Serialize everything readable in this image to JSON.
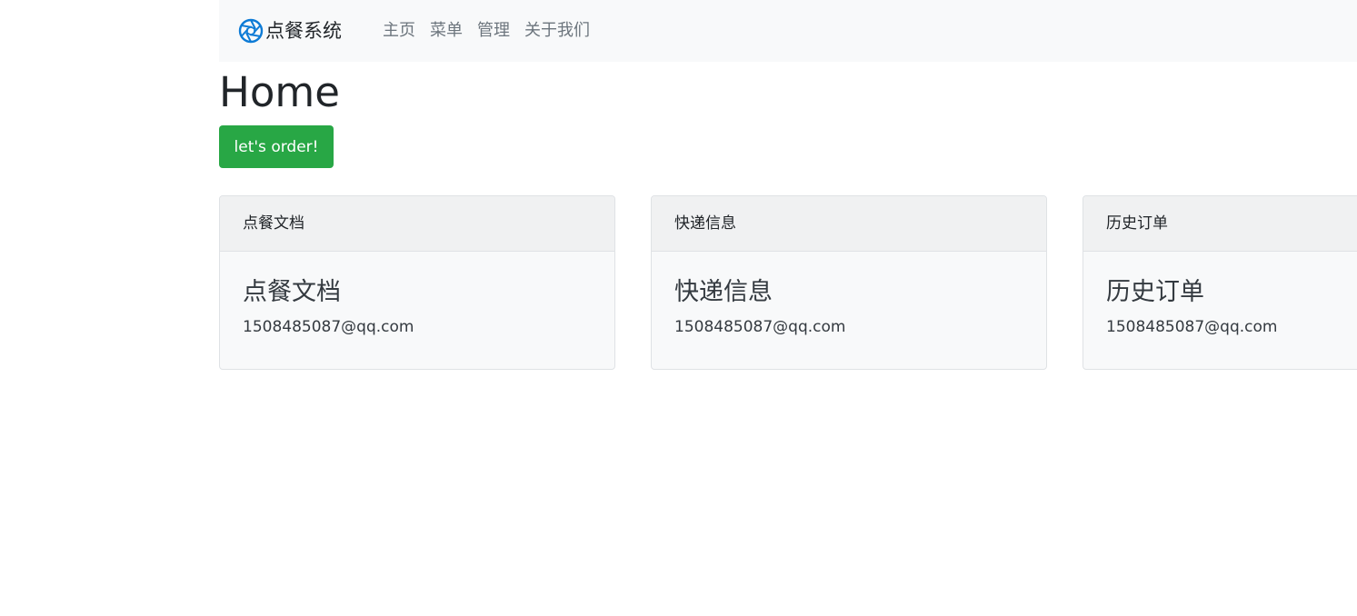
{
  "navbar": {
    "brand": "点餐系统",
    "brand_icon": "aperture-icon",
    "brand_color": "#0d7bd6",
    "links": [
      "主页",
      "菜单",
      "管理",
      "关于我们"
    ]
  },
  "main": {
    "title": "Home",
    "order_button": "let's order!",
    "order_button_color": "#28a745"
  },
  "cards": [
    {
      "header": "点餐文档",
      "title": "点餐文档",
      "text": "1508485087@qq.com"
    },
    {
      "header": "快递信息",
      "title": "快递信息",
      "text": "1508485087@qq.com"
    },
    {
      "header": "历史订单",
      "title": "历史订单",
      "text": "1508485087@qq.com"
    }
  ]
}
